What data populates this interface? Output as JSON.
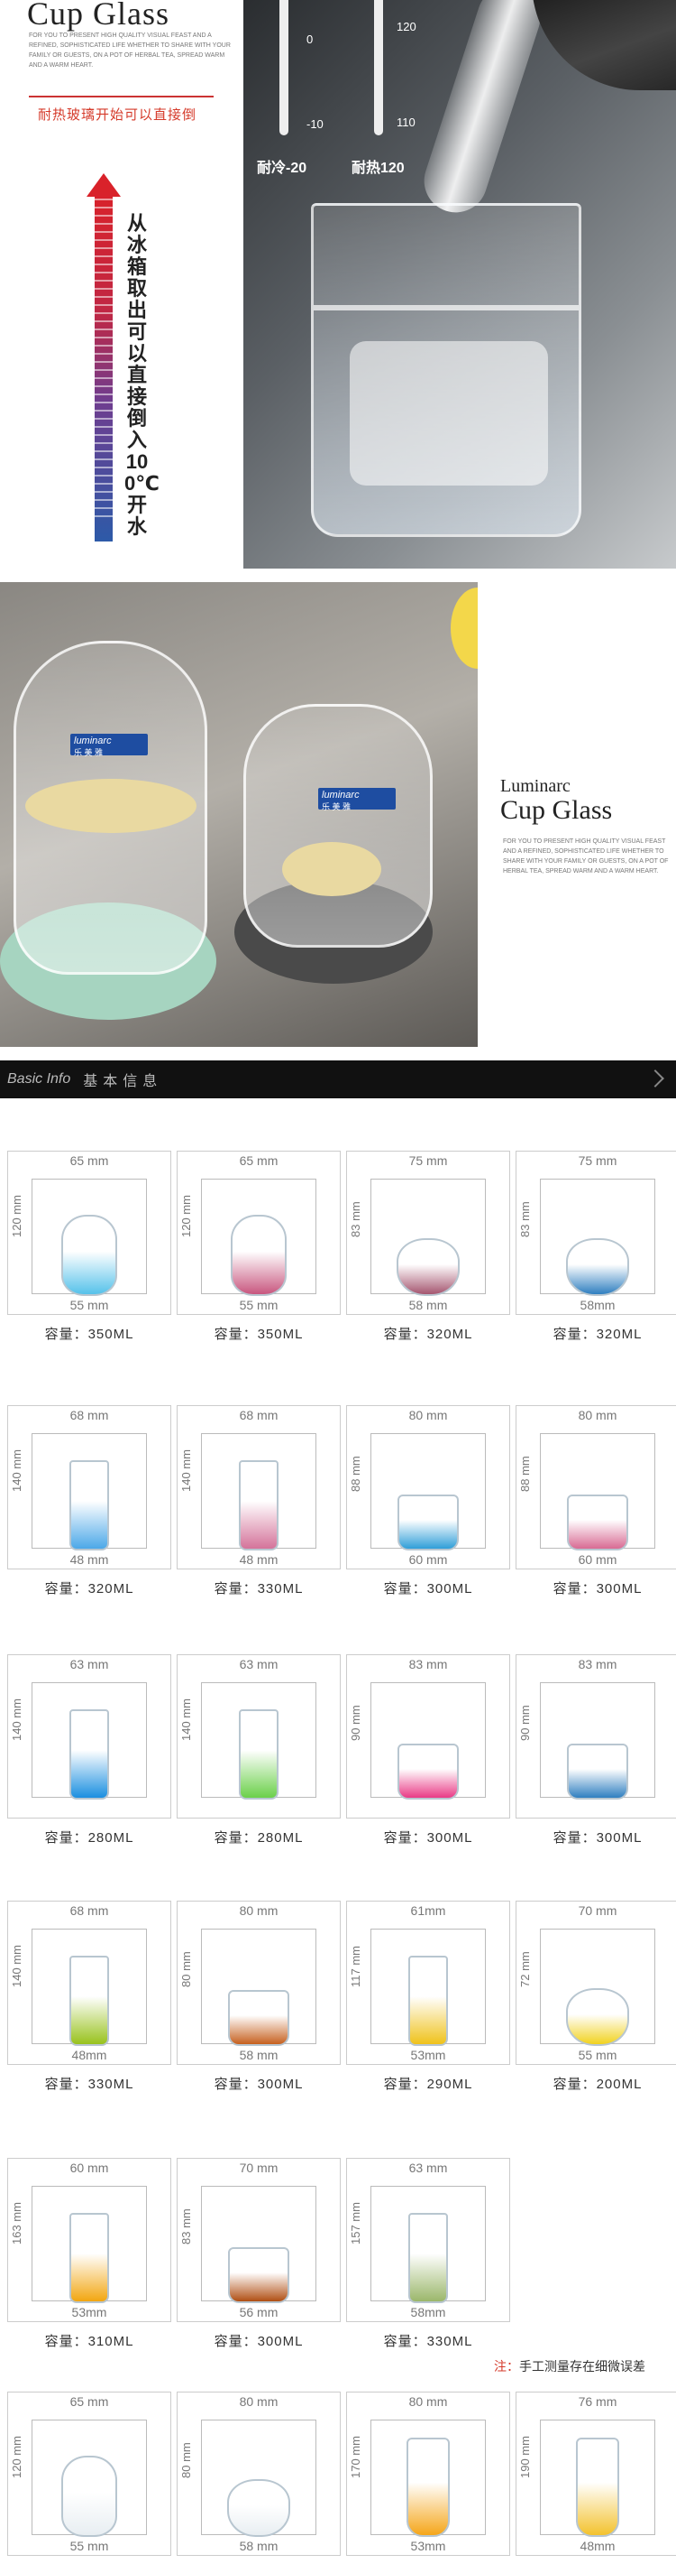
{
  "hero1": {
    "title": "Cup Glass",
    "intro": "FOR YOU TO PRESENT HIGH QUALITY VISUAL FEAST AND A REFINED, SOPHISTICATED LIFE WHETHER TO SHARE WITH YOUR FAMILY OR GUESTS, ON A POT OF HERBAL TEA, SPREAD WARM AND A WARM HEART.",
    "heat_caption": "耐热玻璃开始可以直接倒",
    "vertical_text": "从冰箱取出可以直接倒入100℃开水",
    "thermo_left_ticks": [
      "0",
      "-10"
    ],
    "thermo_right_ticks": [
      "120",
      "110"
    ],
    "thermo_left_caption": "耐冷-20",
    "thermo_right_caption": "耐热120"
  },
  "hero2": {
    "brand": "Luminarc",
    "title": "Cup Glass",
    "intro": "FOR YOU TO PRESENT HIGH QUALITY VISUAL FEAST AND A REFINED, SOPHISTICATED LIFE WHETHER TO SHARE WITH YOUR FAMILY OR GUESTS, ON A POT OF HERBAL TEA, SPREAD WARM AND A WARM HEART.",
    "badge_en": "luminarc",
    "badge_cn": "乐 美 雅"
  },
  "section": {
    "en": "Basic Info",
    "cn": "基本信息"
  },
  "products": [
    {
      "top": "65 mm",
      "side": "120 mm",
      "bottom": "55 mm",
      "cap": "容量：350ML",
      "shape": "tumbler",
      "tint": "#56c2ea"
    },
    {
      "top": "65 mm",
      "side": "120 mm",
      "bottom": "55 mm",
      "cap": "容量：350ML",
      "shape": "tumbler",
      "tint": "#c8577f"
    },
    {
      "top": "75 mm",
      "side": "83 mm",
      "bottom": "58 mm",
      "cap": "容量：320ML",
      "shape": "round",
      "tint": "#a55670"
    },
    {
      "top": "75 mm",
      "side": "83 mm",
      "bottom": "58mm",
      "cap": "容量：320ML",
      "shape": "round",
      "tint": "#2f7fc0"
    },
    {
      "top": "68 mm",
      "side": "140 mm",
      "bottom": "48 mm",
      "cap": "容量：320ML",
      "shape": "straight",
      "tint": "#4ca8e8"
    },
    {
      "top": "68 mm",
      "side": "140 mm",
      "bottom": "48 mm",
      "cap": "容量：330ML",
      "shape": "straight",
      "tint": "#d4739a"
    },
    {
      "top": "80 mm",
      "side": "88 mm",
      "bottom": "60 mm",
      "cap": "容量：300ML",
      "shape": "short",
      "tint": "#2f9ed8"
    },
    {
      "top": "80 mm",
      "side": "88 mm",
      "bottom": "60 mm",
      "cap": "容量：300ML",
      "shape": "short",
      "tint": "#d86b93"
    },
    {
      "top": "63 mm",
      "side": "140 mm",
      "bottom": "",
      "cap": "容量：280ML",
      "shape": "straight",
      "tint": "#1b8fe0"
    },
    {
      "top": "63 mm",
      "side": "140 mm",
      "bottom": "",
      "cap": "容量：280ML",
      "shape": "straight",
      "tint": "#6bd04a"
    },
    {
      "top": "83 mm",
      "side": "90 mm",
      "bottom": "",
      "cap": "容量：300ML",
      "shape": "short",
      "tint": "#e93b86"
    },
    {
      "top": "83 mm",
      "side": "90 mm",
      "bottom": "",
      "cap": "容量：300ML",
      "shape": "short",
      "tint": "#2f7fc0"
    },
    {
      "top": "68 mm",
      "side": "140 mm",
      "bottom": "48mm",
      "cap": "容量：330ML",
      "shape": "straight",
      "tint": "#98c21d"
    },
    {
      "top": "80 mm",
      "side": "80 mm",
      "bottom": "58 mm",
      "cap": "容量：300ML",
      "shape": "short",
      "tint": "#c6611f"
    },
    {
      "top": "61mm",
      "side": "117 mm",
      "bottom": "53mm",
      "cap": "容量：290ML",
      "shape": "straight",
      "tint": "#efc21b"
    },
    {
      "top": "70 mm",
      "side": "72 mm",
      "bottom": "55 mm",
      "cap": "容量：200ML",
      "shape": "round",
      "tint": "#f1d21f"
    },
    {
      "top": "60 mm",
      "side": "163 mm",
      "bottom": "53mm",
      "cap": "容量：310ML",
      "shape": "straight",
      "tint": "#f2a611"
    },
    {
      "top": "70 mm",
      "side": "83 mm",
      "bottom": "56 mm",
      "cap": "容量：300ML",
      "shape": "short",
      "tint": "#b04f14"
    },
    {
      "top": "63 mm",
      "side": "157 mm",
      "bottom": "58mm",
      "cap": "容量：330ML",
      "shape": "straight",
      "tint": "#9bb76b"
    },
    {
      "top": "65 mm",
      "side": "120 mm",
      "bottom": "55 mm",
      "cap": "",
      "shape": "tumbler",
      "tint": "#e8eef2"
    },
    {
      "top": "80 mm",
      "side": "80 mm",
      "bottom": "58 mm",
      "cap": "",
      "shape": "round",
      "tint": "#e8eef2"
    },
    {
      "top": "80 mm",
      "side": "170 mm",
      "bottom": "53mm",
      "cap": "",
      "shape": "cone",
      "tint": "#f5a61a"
    },
    {
      "top": "76 mm",
      "side": "190 mm",
      "bottom": "48mm",
      "cap": "",
      "shape": "cone",
      "tint": "#f3c22e"
    }
  ],
  "note": {
    "mark": "注：",
    "text": "手工测量存在细微误差"
  }
}
